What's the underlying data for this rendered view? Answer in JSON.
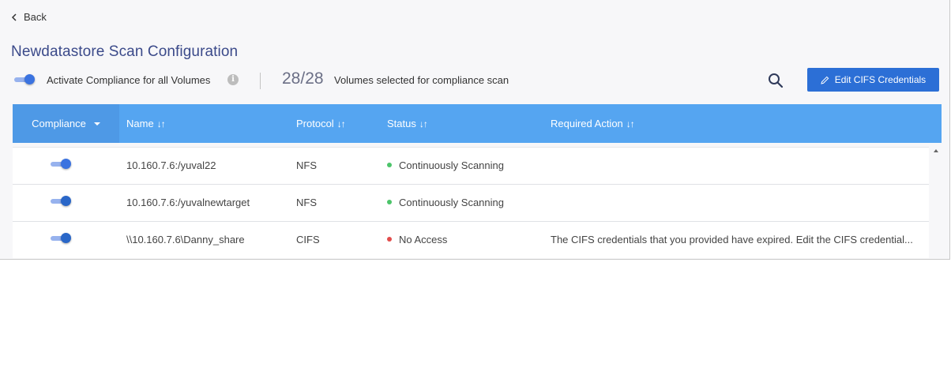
{
  "back_label": "Back",
  "page_title": "Newdatastore Scan Configuration",
  "activate": {
    "label_prefix": "Activate Compliance for",
    "label_target": "all Volumes",
    "info": "i"
  },
  "selection": {
    "count": "28/28",
    "label": "Volumes selected for compliance scan"
  },
  "edit_button_label": "Edit CIFS Credentials",
  "columns": {
    "compliance": "Compliance",
    "name": "Name",
    "protocol": "Protocol",
    "status": "Status",
    "required_action": "Required Action",
    "sort_glyph": "↓↑"
  },
  "rows": [
    {
      "name": "10.160.7.6:/yuval22",
      "protocol": "NFS",
      "status": "Continuously Scanning",
      "required_action": ""
    },
    {
      "name": "10.160.7.6:/yuvalnewtarget",
      "protocol": "NFS",
      "status": "Continuously Scanning",
      "required_action": ""
    },
    {
      "name": "\\\\10.160.7.6\\Danny_share",
      "protocol": "CIFS",
      "status": "No Access",
      "required_action": "The CIFS credentials that you provided have expired. Edit the CIFS credential..."
    }
  ],
  "colors": {
    "accent": "#2c6fd6",
    "header": "#55a5f1",
    "status_ok": "#4cc46a",
    "status_error": "#e24c4b"
  }
}
